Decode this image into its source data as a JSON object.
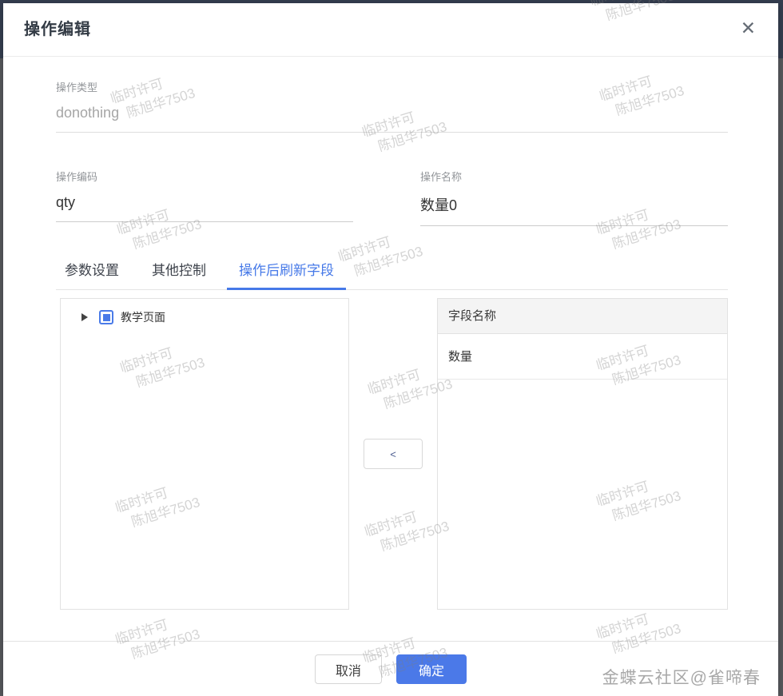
{
  "dialog": {
    "title": "操作编辑",
    "close_glyph": "✕"
  },
  "fields": {
    "type_label": "操作类型",
    "type_value": "donothing",
    "code_label": "操作编码",
    "code_value": "qty",
    "name_label": "操作名称",
    "name_value": "数量0"
  },
  "tabs": [
    {
      "label": "参数设置",
      "active": false
    },
    {
      "label": "其他控制",
      "active": false
    },
    {
      "label": "操作后刷新字段",
      "active": true
    }
  ],
  "tree": {
    "root_label": "教学页面",
    "checkbox_state": "indeterminate",
    "expanded": false
  },
  "transfer": {
    "move_left_label": "<"
  },
  "table": {
    "header": "字段名称",
    "rows": [
      "数量"
    ]
  },
  "footer": {
    "cancel_label": "取消",
    "confirm_label": "确定"
  },
  "watermark": {
    "line1": "临时许可",
    "line2": "陈旭华7503"
  },
  "credit": "金蝶云社区@雀啼春",
  "colors": {
    "accent": "#4679e8",
    "confirm_button": "#4b79e8",
    "top_bar": "#353e50",
    "overlay_gray": "#57595d"
  }
}
